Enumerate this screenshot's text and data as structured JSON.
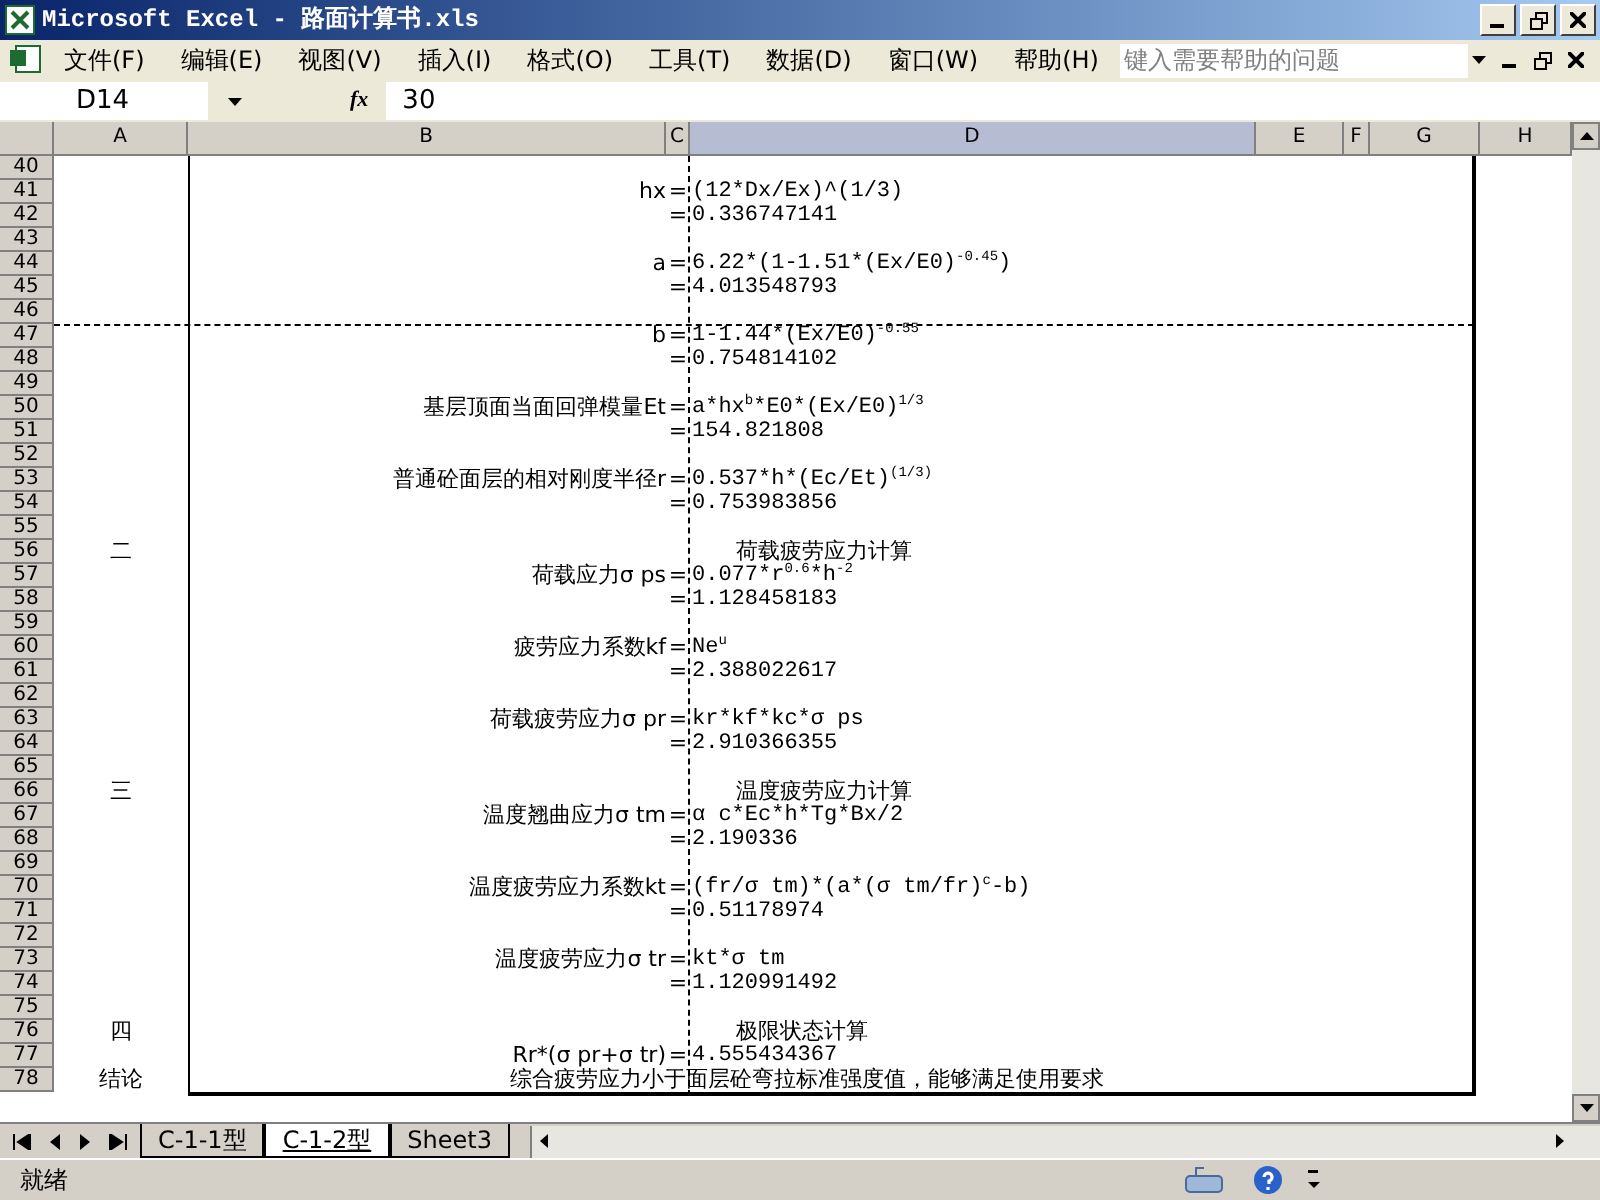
{
  "window": {
    "title": "Microsoft Excel - 路面计算书.xls"
  },
  "menu": [
    "文件(F)",
    "编辑(E)",
    "视图(V)",
    "插入(I)",
    "格式(O)",
    "工具(T)",
    "数据(D)",
    "窗口(W)",
    "帮助(H)"
  ],
  "help_box": {
    "placeholder": "键入需要帮助的问题"
  },
  "name_box": {
    "value": "D14"
  },
  "formula_bar": {
    "fx": "fx",
    "value": "30"
  },
  "columns": [
    {
      "label": "A",
      "selected": false
    },
    {
      "label": "B",
      "selected": false
    },
    {
      "label": "C",
      "selected": false
    },
    {
      "label": "D",
      "selected": true
    },
    {
      "label": "E",
      "selected": false
    },
    {
      "label": "F",
      "selected": false
    },
    {
      "label": "G",
      "selected": false
    },
    {
      "label": "H",
      "selected": false
    }
  ],
  "rows": [
    {
      "number": "40",
      "kind": "line"
    },
    {
      "number": "41",
      "kind": "line",
      "b": "hx",
      "c": "=",
      "d": "(12*Dx/Ex)^(1/3)"
    },
    {
      "number": "42",
      "kind": "line",
      "c": "=",
      "d": "0.336747141"
    },
    {
      "number": "43",
      "kind": "line"
    },
    {
      "number": "44",
      "kind": "line",
      "b": "a",
      "c": "=",
      "d": "6.22*(1-1.51*(Ex/E0)$^{-0.45}$)"
    },
    {
      "number": "45",
      "kind": "line",
      "c": "=",
      "d": "4.013548793"
    },
    {
      "number": "46",
      "kind": "line"
    },
    {
      "number": "47",
      "kind": "line",
      "page_break": true,
      "b": "b",
      "c": "=",
      "d": "1-1.44*(Ex/E0)$^{-0.55}$"
    },
    {
      "number": "48",
      "kind": "line",
      "c": "=",
      "d": "0.754814102"
    },
    {
      "number": "49",
      "kind": "line"
    },
    {
      "number": "50",
      "kind": "line",
      "b": "基层顶面当面回弹模量Et",
      "c": "=",
      "d": [
        {
          "text": "a*hx",
          "raised": false
        },
        {
          "text": "b",
          "raised": true
        },
        {
          "text": "*E0*(Ex/E0)",
          "raised": false
        },
        {
          "text": "1/3",
          "raised": true
        }
      ]
    },
    {
      "number": "51",
      "kind": "line",
      "c": "=",
      "d": "154.821808"
    },
    {
      "number": "52",
      "kind": "line"
    },
    {
      "number": "53",
      "kind": "line",
      "b": "普通砼面层的相对刚度半径r",
      "c": "=",
      "d": "0.537*h*(Ec/Et)$^{(1/3)}$"
    },
    {
      "number": "54",
      "kind": "line",
      "c": "=",
      "d": "0.753983856"
    },
    {
      "number": "55",
      "kind": "line"
    },
    {
      "number": "56",
      "kind": "section",
      "a": "二",
      "d": "荷载疲劳应力计算"
    },
    {
      "number": "57",
      "kind": "line",
      "b": "荷载应力σ ps",
      "c": "=",
      "d": "0.077*r$^{0.6}$*h$^{-2}$"
    },
    {
      "number": "58",
      "kind": "line",
      "c": "=",
      "d": "1.128458183"
    },
    {
      "number": "59",
      "kind": "line"
    },
    {
      "number": "60",
      "kind": "line",
      "b": "疲劳应力系数kf",
      "c": "=",
      "d": "Ne$^{u}$"
    },
    {
      "number": "61",
      "kind": "line",
      "c": "=",
      "d": "2.388022617"
    },
    {
      "number": "62",
      "kind": "line"
    },
    {
      "number": "63",
      "kind": "line",
      "b": "荷载疲劳应力σ pr",
      "c": "=",
      "d": "kr*kf*kc*σ ps"
    },
    {
      "number": "64",
      "kind": "line",
      "c": "=",
      "d": "2.910366355"
    },
    {
      "number": "65",
      "kind": "line"
    },
    {
      "number": "66",
      "kind": "section",
      "a": "三",
      "d": "温度疲劳应力计算"
    },
    {
      "number": "67",
      "kind": "line",
      "b": "温度翘曲应力σ tm",
      "c": "=",
      "d": "α c*Ec*h*Tg*Bx/2"
    },
    {
      "number": "68",
      "kind": "line",
      "c": "=",
      "d": "2.190336"
    },
    {
      "number": "69",
      "kind": "line"
    },
    {
      "number": "70",
      "kind": "line",
      "b": "温度疲劳应力系数kt",
      "c": "=",
      "d": [
        {
          "text": "(fr/σ tm)*(a*(σ tm/fr)",
          "raised": false
        },
        {
          "text": "c",
          "raised": true
        },
        {
          "text": "-b)",
          "raised": false
        }
      ]
    },
    {
      "number": "71",
      "kind": "line",
      "c": "=",
      "d": "0.51178974"
    },
    {
      "number": "72",
      "kind": "line"
    },
    {
      "number": "73",
      "kind": "line",
      "b": "温度疲劳应力σ tr",
      "c": "=",
      "d": "kt*σ tm"
    },
    {
      "number": "74",
      "kind": "line",
      "c": "=",
      "d": "1.120991492"
    },
    {
      "number": "75",
      "kind": "line"
    },
    {
      "number": "76",
      "kind": "section",
      "a": "四",
      "d": "极限状态计算"
    },
    {
      "number": "77",
      "kind": "line",
      "b": "Rr*(σ pr+σ tr)",
      "c": "=",
      "d": "4.555434367"
    },
    {
      "number": "78",
      "kind": "conclusion",
      "a": "结论",
      "note": "综合疲劳应力小于面层砼弯拉标准强度值，能够满足使用要求"
    }
  ],
  "sheet_tabs": [
    {
      "label": "C-1-1型",
      "selected": false
    },
    {
      "label": "C-1-2型",
      "selected": true
    },
    {
      "label": "Sheet3",
      "selected": false
    }
  ],
  "status_bar": {
    "text": "就绪"
  }
}
